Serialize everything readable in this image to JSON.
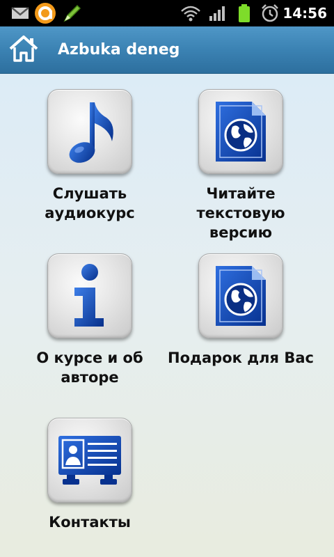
{
  "status_bar": {
    "time": "14:56",
    "icons": [
      "gmail-icon",
      "notification-app-icon",
      "pencil-icon",
      "wifi-icon",
      "signal-icon",
      "battery-icon",
      "alarm-icon"
    ]
  },
  "action_bar": {
    "title": "Azbuka deneg",
    "home_icon": "home-icon"
  },
  "menu": {
    "items": [
      {
        "label": "Слушать аудиокурс",
        "icon": "music-note-icon"
      },
      {
        "label": "Читайте текстовую версию",
        "icon": "globe-document-icon"
      },
      {
        "label": "О курсе и об авторе",
        "icon": "info-icon"
      },
      {
        "label": "Подарок для Вас",
        "icon": "globe-document-icon"
      },
      {
        "label": "Контакты",
        "icon": "contact-card-icon"
      }
    ]
  },
  "colors": {
    "action_bar": "#3b82b3",
    "icon_blue": "#0b3fa8",
    "background_top": "#d9ebf8",
    "background_bottom": "#e8ecdf"
  }
}
